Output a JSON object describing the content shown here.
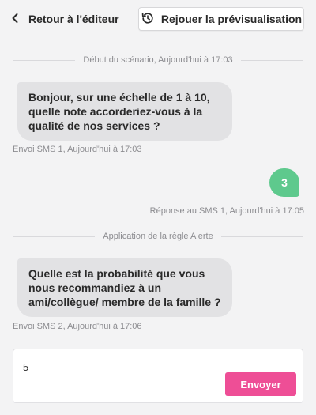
{
  "header": {
    "back_label": "Retour à l'éditeur",
    "back_icon": "chevron-left-icon",
    "replay_label": "Rejouer la prévisualisation",
    "replay_icon": "replay-history-icon"
  },
  "conversation": {
    "start_divider": "Début du scénario, Aujourd'hui à 17:03",
    "messages": [
      {
        "direction": "in",
        "text": "Bonjour, sur une échelle de 1 à 10, quelle note accorderiez-vous à la qualité de nos services ?",
        "meta": "Envoi SMS 1, Aujourd'hui à 17:03"
      },
      {
        "direction": "out",
        "text": "3",
        "meta": "Réponse au SMS 1, Aujourd'hui à 17:05"
      },
      {
        "direction": "in",
        "text": "Quelle est la probabilité que vous nous recommandiez à un ami/collègue/ membre de la famille ?",
        "meta": "Envoi SMS 2, Aujourd'hui à 17:06"
      }
    ],
    "rule_divider": "Application de la règle Alerte"
  },
  "composer": {
    "value": "5",
    "send_label": "Envoyer"
  },
  "colors": {
    "background": "#f3f3f4",
    "incoming_bubble": "#e2e2e4",
    "outgoing_bubble": "#5ec98d",
    "send_button": "#ee4e96"
  }
}
